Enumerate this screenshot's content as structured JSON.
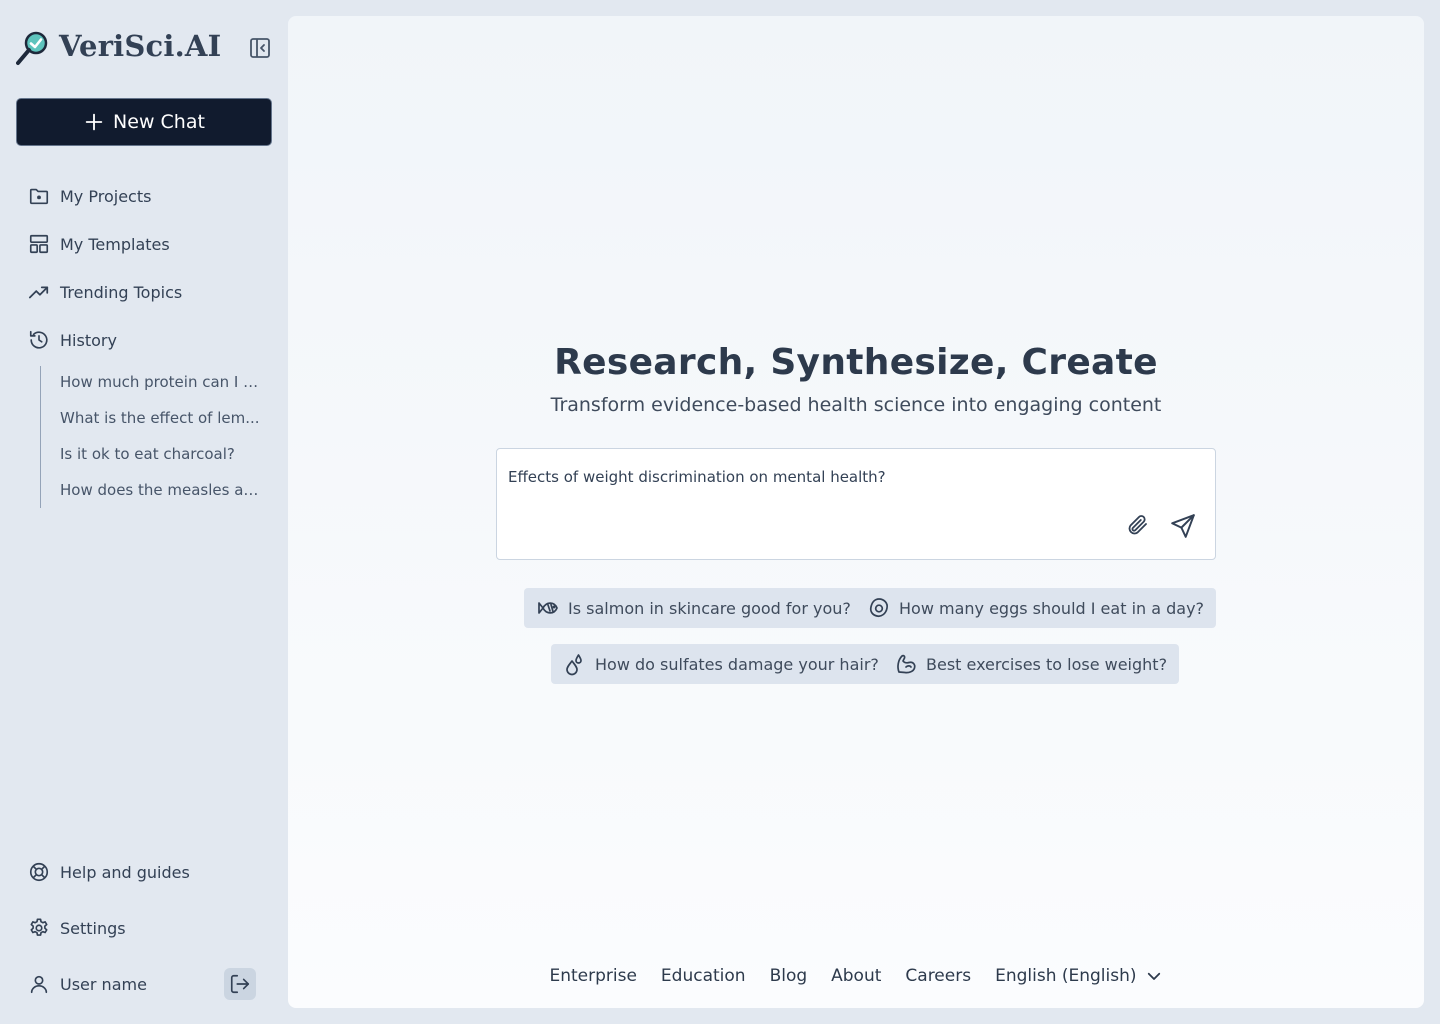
{
  "app": {
    "name": "VeriSci.AI"
  },
  "sidebar": {
    "new_chat_label": "New Chat",
    "nav": [
      {
        "label": "My Projects",
        "icon": "folder-icon"
      },
      {
        "label": "My Templates",
        "icon": "templates-icon"
      },
      {
        "label": "Trending Topics",
        "icon": "trending-icon"
      },
      {
        "label": "History",
        "icon": "history-icon"
      }
    ],
    "history": [
      "How much protein can I e...",
      "What is the effect of lem...",
      "Is it ok to eat charcoal?",
      "How does the measles aff..."
    ],
    "bottom": {
      "help_label": "Help and guides",
      "settings_label": "Settings",
      "user_label": "User name"
    }
  },
  "main": {
    "title": "Research, Synthesize, Create",
    "subtitle": "Transform evidence-based health science into engaging content",
    "prompt": {
      "value": "Effects of weight discrimination on mental health?"
    },
    "suggestions": [
      {
        "label": "Is salmon in skincare good for you?",
        "icon": "fish-icon"
      },
      {
        "label": "How many eggs should I eat in a day?",
        "icon": "egg-icon"
      },
      {
        "label": "How do sulfates damage your hair?",
        "icon": "droplets-icon"
      },
      {
        "label": "Best exercises to lose weight?",
        "icon": "bicep-icon"
      }
    ]
  },
  "footer": {
    "links": [
      "Enterprise",
      "Education",
      "Blog",
      "About",
      "Careers"
    ],
    "language": "English (English)"
  },
  "colors": {
    "sidebar_bg": "#e2e8f0",
    "new_chat_bg": "#111b2e",
    "text": "#334155",
    "chip_bg": "#dde4ee",
    "logo_accent": "#5ec4bd"
  }
}
